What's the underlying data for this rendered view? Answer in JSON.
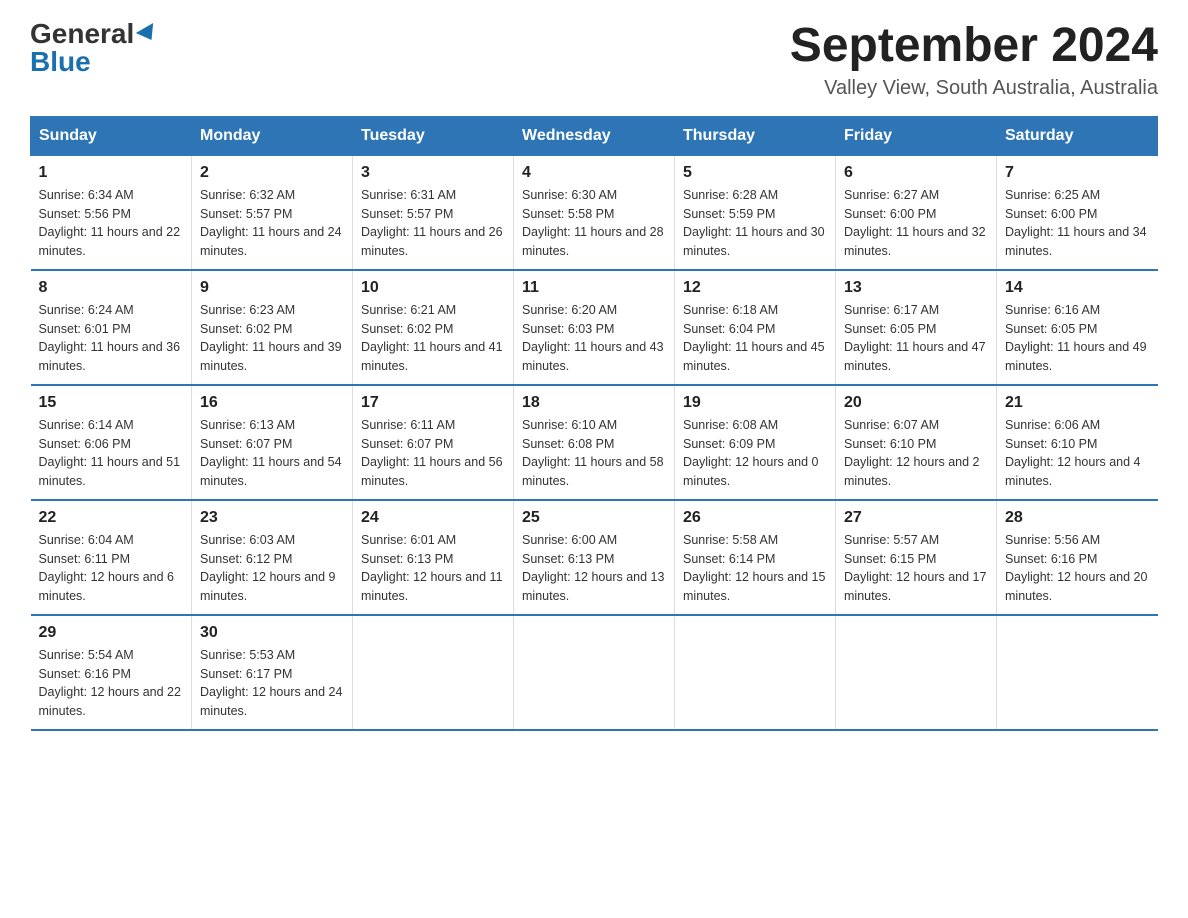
{
  "header": {
    "logo_general": "General",
    "logo_blue": "Blue",
    "month_title": "September 2024",
    "location": "Valley View, South Australia, Australia"
  },
  "days_of_week": [
    "Sunday",
    "Monday",
    "Tuesday",
    "Wednesday",
    "Thursday",
    "Friday",
    "Saturday"
  ],
  "weeks": [
    [
      {
        "day": "1",
        "sunrise": "6:34 AM",
        "sunset": "5:56 PM",
        "daylight": "11 hours and 22 minutes."
      },
      {
        "day": "2",
        "sunrise": "6:32 AM",
        "sunset": "5:57 PM",
        "daylight": "11 hours and 24 minutes."
      },
      {
        "day": "3",
        "sunrise": "6:31 AM",
        "sunset": "5:57 PM",
        "daylight": "11 hours and 26 minutes."
      },
      {
        "day": "4",
        "sunrise": "6:30 AM",
        "sunset": "5:58 PM",
        "daylight": "11 hours and 28 minutes."
      },
      {
        "day": "5",
        "sunrise": "6:28 AM",
        "sunset": "5:59 PM",
        "daylight": "11 hours and 30 minutes."
      },
      {
        "day": "6",
        "sunrise": "6:27 AM",
        "sunset": "6:00 PM",
        "daylight": "11 hours and 32 minutes."
      },
      {
        "day": "7",
        "sunrise": "6:25 AM",
        "sunset": "6:00 PM",
        "daylight": "11 hours and 34 minutes."
      }
    ],
    [
      {
        "day": "8",
        "sunrise": "6:24 AM",
        "sunset": "6:01 PM",
        "daylight": "11 hours and 36 minutes."
      },
      {
        "day": "9",
        "sunrise": "6:23 AM",
        "sunset": "6:02 PM",
        "daylight": "11 hours and 39 minutes."
      },
      {
        "day": "10",
        "sunrise": "6:21 AM",
        "sunset": "6:02 PM",
        "daylight": "11 hours and 41 minutes."
      },
      {
        "day": "11",
        "sunrise": "6:20 AM",
        "sunset": "6:03 PM",
        "daylight": "11 hours and 43 minutes."
      },
      {
        "day": "12",
        "sunrise": "6:18 AM",
        "sunset": "6:04 PM",
        "daylight": "11 hours and 45 minutes."
      },
      {
        "day": "13",
        "sunrise": "6:17 AM",
        "sunset": "6:05 PM",
        "daylight": "11 hours and 47 minutes."
      },
      {
        "day": "14",
        "sunrise": "6:16 AM",
        "sunset": "6:05 PM",
        "daylight": "11 hours and 49 minutes."
      }
    ],
    [
      {
        "day": "15",
        "sunrise": "6:14 AM",
        "sunset": "6:06 PM",
        "daylight": "11 hours and 51 minutes."
      },
      {
        "day": "16",
        "sunrise": "6:13 AM",
        "sunset": "6:07 PM",
        "daylight": "11 hours and 54 minutes."
      },
      {
        "day": "17",
        "sunrise": "6:11 AM",
        "sunset": "6:07 PM",
        "daylight": "11 hours and 56 minutes."
      },
      {
        "day": "18",
        "sunrise": "6:10 AM",
        "sunset": "6:08 PM",
        "daylight": "11 hours and 58 minutes."
      },
      {
        "day": "19",
        "sunrise": "6:08 AM",
        "sunset": "6:09 PM",
        "daylight": "12 hours and 0 minutes."
      },
      {
        "day": "20",
        "sunrise": "6:07 AM",
        "sunset": "6:10 PM",
        "daylight": "12 hours and 2 minutes."
      },
      {
        "day": "21",
        "sunrise": "6:06 AM",
        "sunset": "6:10 PM",
        "daylight": "12 hours and 4 minutes."
      }
    ],
    [
      {
        "day": "22",
        "sunrise": "6:04 AM",
        "sunset": "6:11 PM",
        "daylight": "12 hours and 6 minutes."
      },
      {
        "day": "23",
        "sunrise": "6:03 AM",
        "sunset": "6:12 PM",
        "daylight": "12 hours and 9 minutes."
      },
      {
        "day": "24",
        "sunrise": "6:01 AM",
        "sunset": "6:13 PM",
        "daylight": "12 hours and 11 minutes."
      },
      {
        "day": "25",
        "sunrise": "6:00 AM",
        "sunset": "6:13 PM",
        "daylight": "12 hours and 13 minutes."
      },
      {
        "day": "26",
        "sunrise": "5:58 AM",
        "sunset": "6:14 PM",
        "daylight": "12 hours and 15 minutes."
      },
      {
        "day": "27",
        "sunrise": "5:57 AM",
        "sunset": "6:15 PM",
        "daylight": "12 hours and 17 minutes."
      },
      {
        "day": "28",
        "sunrise": "5:56 AM",
        "sunset": "6:16 PM",
        "daylight": "12 hours and 20 minutes."
      }
    ],
    [
      {
        "day": "29",
        "sunrise": "5:54 AM",
        "sunset": "6:16 PM",
        "daylight": "12 hours and 22 minutes."
      },
      {
        "day": "30",
        "sunrise": "5:53 AM",
        "sunset": "6:17 PM",
        "daylight": "12 hours and 24 minutes."
      },
      null,
      null,
      null,
      null,
      null
    ]
  ],
  "labels": {
    "sunrise": "Sunrise:",
    "sunset": "Sunset:",
    "daylight": "Daylight:"
  }
}
